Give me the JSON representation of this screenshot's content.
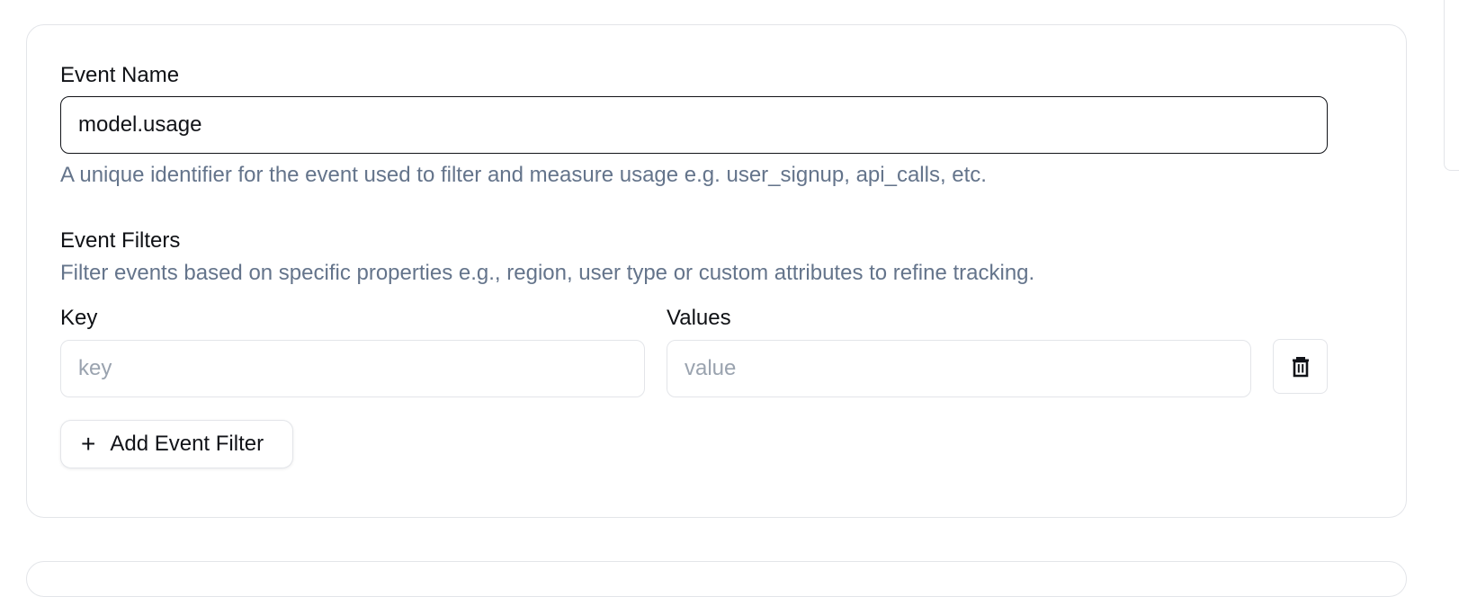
{
  "event_name": {
    "label": "Event Name",
    "value": "model.usage",
    "help": "A unique identifier for the event used to filter and measure usage e.g. user_signup, api_calls, etc."
  },
  "event_filters": {
    "label": "Event Filters",
    "help": "Filter events based on specific properties e.g., region, user type or custom attributes to refine tracking.",
    "key_label": "Key",
    "values_label": "Values",
    "key_placeholder": "key",
    "value_placeholder": "value",
    "add_button_label": "Add Event Filter",
    "add_button_icon": "plus-icon",
    "delete_icon": "trash-icon"
  }
}
